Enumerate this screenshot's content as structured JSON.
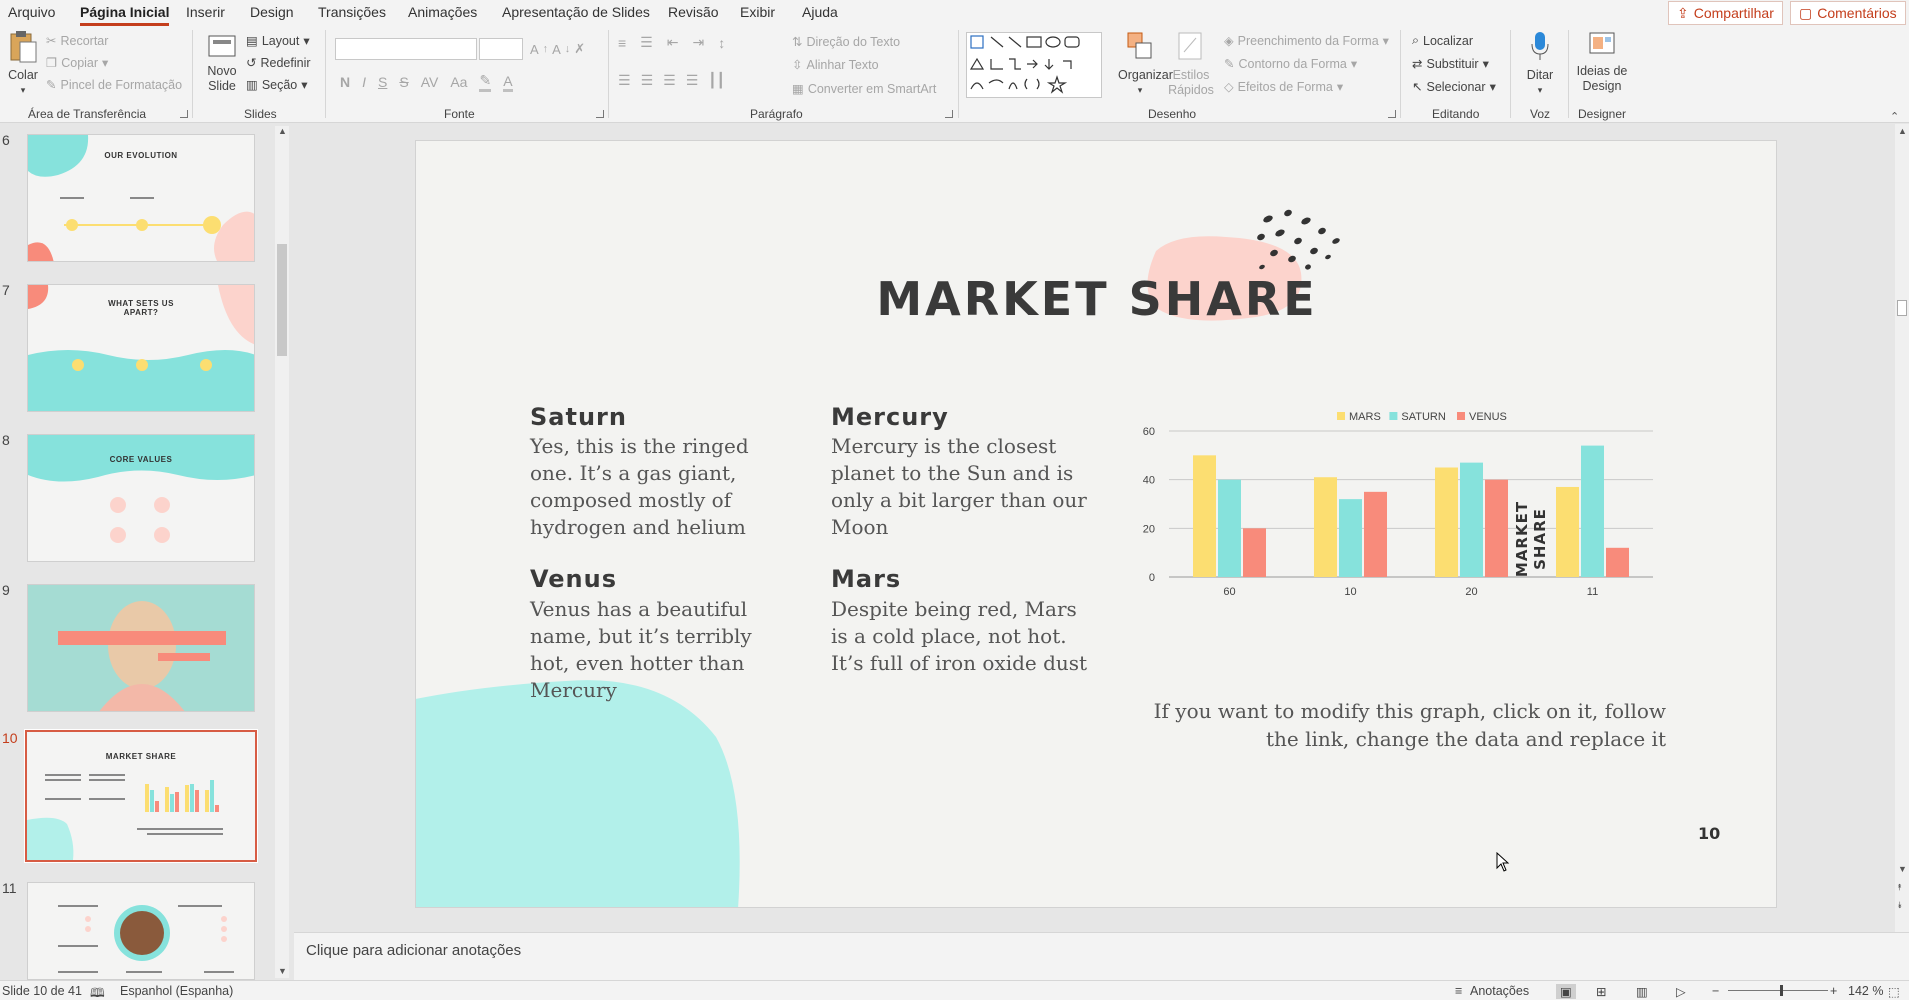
{
  "menu": {
    "tabs": [
      "Arquivo",
      "Página Inicial",
      "Inserir",
      "Design",
      "Transições",
      "Animações",
      "Apresentação de Slides",
      "Revisão",
      "Exibir",
      "Ajuda"
    ],
    "active_tab": "Página Inicial",
    "share_label": "Compartilhar",
    "comments_label": "Comentários"
  },
  "ribbon": {
    "clipboard": {
      "group": "Área de Transferência",
      "paste": "Colar",
      "cut": "Recortar",
      "copy": "Copiar",
      "format_painter": "Pincel de Formatação"
    },
    "slides": {
      "group": "Slides",
      "new_slide": "Novo Slide",
      "layout": "Layout",
      "reset": "Redefinir",
      "section": "Seção"
    },
    "font": {
      "group": "Fonte",
      "bold": "N",
      "italic": "I",
      "underline": "S",
      "strike": "S",
      "spacing": "AV",
      "case": "Aa"
    },
    "paragraph": {
      "group": "Parágrafo",
      "text_direction": "Direção do Texto",
      "align_text": "Alinhar Texto",
      "smartart": "Converter em SmartArt"
    },
    "drawing": {
      "group": "Desenho",
      "arrange": "Organizar",
      "quick_styles": "Estilos Rápidos",
      "shape_fill": "Preenchimento da Forma",
      "shape_outline": "Contorno da Forma",
      "shape_effects": "Efeitos de Forma"
    },
    "editing": {
      "group": "Editando",
      "find": "Localizar",
      "replace": "Substituir",
      "select": "Selecionar"
    },
    "voice": {
      "group": "Voz",
      "dictate": "Ditar"
    },
    "designer": {
      "group": "Designer",
      "design_ideas": "Ideias de Design"
    }
  },
  "thumbnails": [
    {
      "num": "6",
      "title": "OUR EVOLUTION"
    },
    {
      "num": "7",
      "title": "WHAT SETS US APART?"
    },
    {
      "num": "8",
      "title": "CORE VALUES"
    },
    {
      "num": "9",
      "title": ""
    },
    {
      "num": "10",
      "title": "MARKET SHARE",
      "active": true
    },
    {
      "num": "11",
      "title": ""
    }
  ],
  "slide": {
    "title": "MARKET SHARE",
    "number": "10",
    "side_label": "MARKET SHARE",
    "planets": [
      {
        "name": "Saturn",
        "text": "Yes, this is the ringed one. It’s a gas giant, composed mostly of hydrogen and helium"
      },
      {
        "name": "Mercury",
        "text": "Mercury is the closest planet to the Sun and is only a bit larger than our Moon"
      },
      {
        "name": "Venus",
        "text": "Venus has a beautiful name, but it’s terribly hot, even hotter than Mercury"
      },
      {
        "name": "Mars",
        "text": "Despite being red, Mars is a cold place, not hot. It’s full of iron oxide dust"
      }
    ],
    "chart_note": "If you want to modify this graph, click on it, follow the link, change the data and replace it"
  },
  "chart_data": {
    "type": "bar",
    "categories": [
      "60",
      "10",
      "20",
      "11"
    ],
    "series": [
      {
        "name": "MARS",
        "values": [
          50,
          41,
          45,
          37
        ],
        "color": "#fcde71"
      },
      {
        "name": "SATURN",
        "values": [
          40,
          32,
          47,
          54
        ],
        "color": "#86e2dc"
      },
      {
        "name": "VENUS",
        "values": [
          20,
          35,
          40,
          12
        ],
        "color": "#f88b7b"
      }
    ],
    "ylim": [
      0,
      60
    ],
    "yticks": [
      0,
      20,
      40,
      60
    ],
    "grid": true,
    "legend": "top"
  },
  "notes": {
    "placeholder": "Clique para adicionar anotações"
  },
  "status": {
    "slide_info": "Slide 10 de 41",
    "language": "Espanhol (Espanha)",
    "notes": "Anotações",
    "zoom": "142 %"
  },
  "colors": {
    "accent": "#c43e1c",
    "teal": "#b2f0ea",
    "blush": "#fcd3cc"
  }
}
